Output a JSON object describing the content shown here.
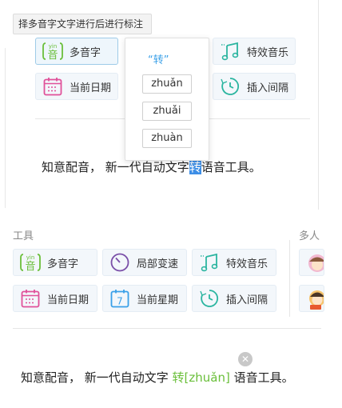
{
  "tooltip": "择多音字文字进行后进行标注",
  "top_toolbar": {
    "polyphone": "多音字",
    "current_date": "当前日期",
    "sound_effect": "特效音乐",
    "insert_interval": "插入间隔"
  },
  "pinyin_popup": {
    "title": "“转”",
    "options": [
      "zhuǎn",
      "zhuǎi",
      "zhuàn"
    ]
  },
  "top_sentence": {
    "before": "知意配音， 新一代自动文字",
    "selected": "转",
    "after": "语音工具。"
  },
  "tools_section": {
    "title": "工具",
    "right_title": "多人",
    "buttons": {
      "polyphone": "多音字",
      "local_speed": "局部变速",
      "sound_effect": "特效音乐",
      "current_date": "当前日期",
      "current_week": "当前星期",
      "insert_interval": "插入间隔"
    },
    "icon_glyphs": {
      "pinyin_yin": "yin",
      "pinyin_char": "音",
      "week_number": "7"
    }
  },
  "bottom_sentence": {
    "before": "知意配音， 新一代自动文字 ",
    "annotated": "转[zhuǎn]",
    "after": " 语音工具。"
  },
  "colors": {
    "green_icon": "#6abf3a",
    "pink_icon": "#e0519a",
    "purple_icon": "#7a4fa8",
    "blue_icon": "#3aa0e8",
    "teal_icon": "#2bb5a0",
    "highlight": "#3d8ee6"
  }
}
